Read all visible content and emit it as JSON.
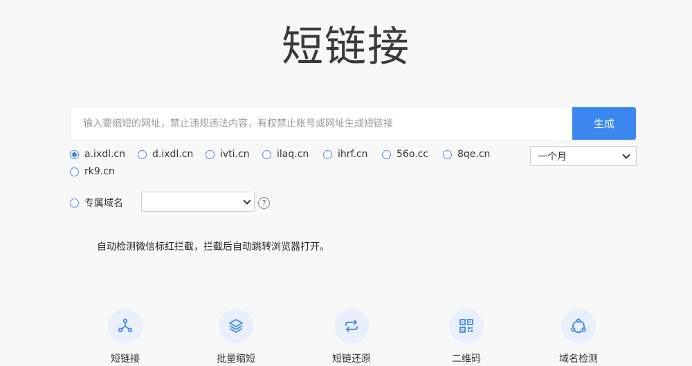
{
  "page": {
    "title": "短链接"
  },
  "search": {
    "placeholder": "输入要缩短的网址，禁止违规违法内容，有权禁止账号或网址生成短链接",
    "value": "",
    "button_label": "生成"
  },
  "domains": [
    {
      "label": "a.ixdl.cn",
      "checked": true
    },
    {
      "label": "d.ixdl.cn",
      "checked": false
    },
    {
      "label": "ivti.cn",
      "checked": false
    },
    {
      "label": "ilaq.cn",
      "checked": false
    },
    {
      "label": "ihrf.cn",
      "checked": false
    },
    {
      "label": "56o.cc",
      "checked": false
    },
    {
      "label": "8qe.cn",
      "checked": false
    },
    {
      "label": "rk9.cn",
      "checked": false
    }
  ],
  "custom_domain": {
    "label": "专属域名",
    "checked": false,
    "selected": ""
  },
  "period": {
    "selected": "一个月"
  },
  "help_symbol": "?",
  "notice": "自动检测微信标红拦截，拦截后自动跳转浏览器打开。",
  "features": [
    {
      "label": "短链接",
      "icon": "share-nodes-icon"
    },
    {
      "label": "批量缩短",
      "icon": "layers-icon"
    },
    {
      "label": "短链还原",
      "icon": "repeat-icon"
    },
    {
      "label": "二维码",
      "icon": "qrcode-icon"
    },
    {
      "label": "域名检测",
      "icon": "cycle-nodes-icon"
    }
  ],
  "colors": {
    "accent": "#3a87f0",
    "icon_bg": "#e9f0fb",
    "background": "#f8f8f8"
  }
}
